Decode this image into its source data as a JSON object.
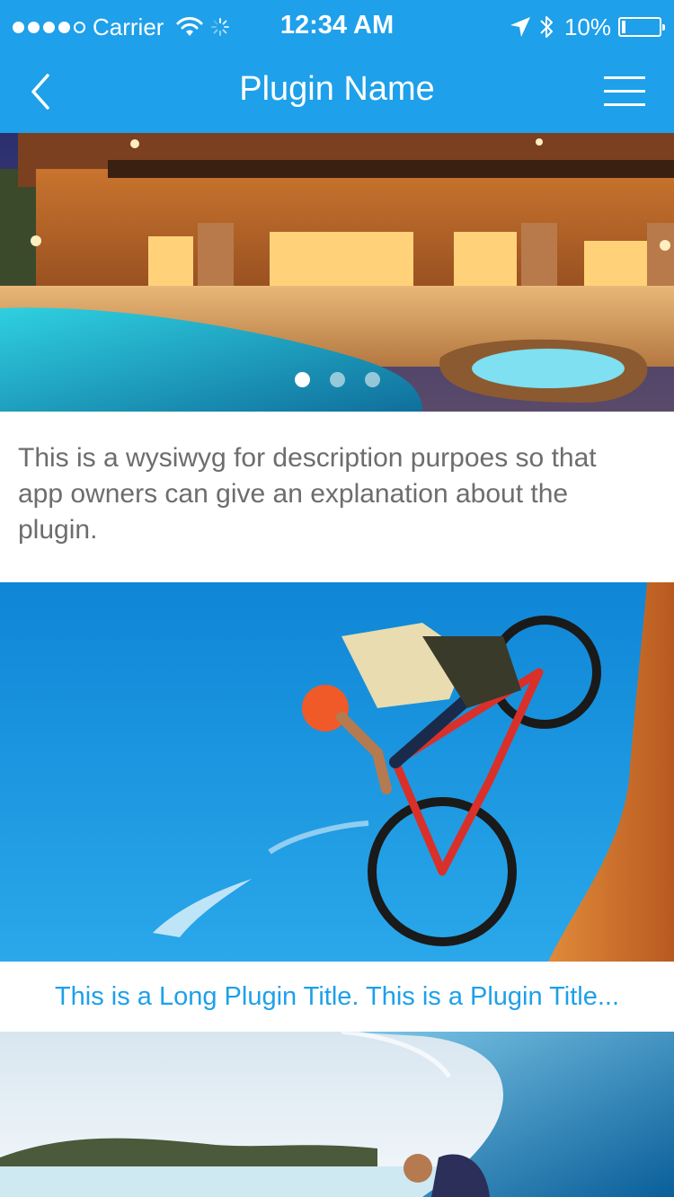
{
  "status_bar": {
    "carrier": "Carrier",
    "time": "12:34 AM",
    "battery": "10%",
    "signal_bars": 4,
    "signal_total": 5,
    "battery_level": 0.1
  },
  "nav": {
    "title": "Plugin Name",
    "back_icon": "chevron-left-icon",
    "menu_icon": "hamburger-menu-icon"
  },
  "carousel": {
    "slide_count": 3,
    "active_index": 0
  },
  "description": "This is a wysiwyg for description purpoes so that app owners can give an explanation about the plugin.",
  "items": [
    {
      "title": "This is a Long Plugin Title. This is a Plugin Title..."
    }
  ],
  "colors": {
    "accent": "#1ea0ea",
    "description_text": "#6d6d6d"
  }
}
